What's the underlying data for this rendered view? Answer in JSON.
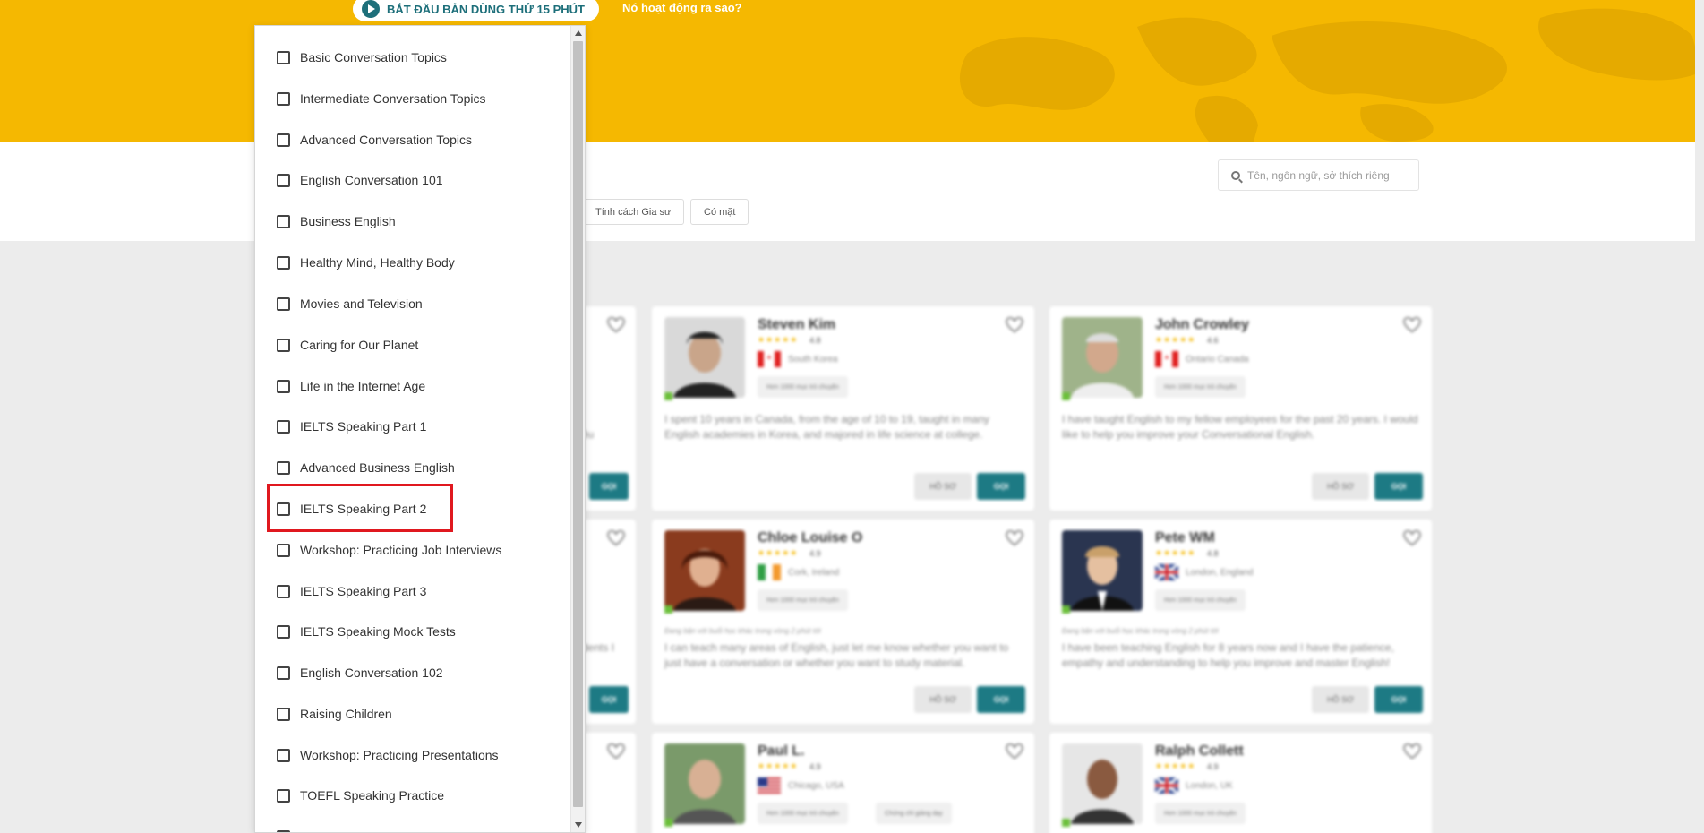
{
  "hero": {
    "trial_button": "BẮT ĐẦU BẢN DÙNG THỬ 15 PHÚT",
    "how_link": "Nó hoạt động ra sao?"
  },
  "filters": {
    "search_placeholder": "Tên, ngôn ngữ, sở thích riêng",
    "chips": [
      "Tính cách Gia sư",
      "Có mặt"
    ]
  },
  "tutors": [
    {
      "name": "Steven Kim",
      "rating": "4.8",
      "country": "South Korea",
      "tag": "Hơn 1000 mục trò chuyện",
      "note": "",
      "bio": "I spent 10 years in Canada, from the age of 10 to 19, taught in many English academies in Korea, and majored in life science at college."
    },
    {
      "name": "John Crowley",
      "rating": "4.6",
      "country": "Ontario Canada",
      "tag": "Hơn 1000 mục trò chuyện",
      "note": "",
      "bio": "I have taught English to my fellow employees for the past 20 years. I would like to help you improve your Conversational English."
    },
    {
      "name": "Chloe Louise O",
      "rating": "4.9",
      "country": "Cork, Ireland",
      "tag": "Hơn 1000 mục trò chuyện",
      "note": "Đang bận với buổi học khác trong vòng 2 phút tới",
      "bio": "I can teach many areas of English, just let me know whether you want to just have a conversation or whether you want to study material."
    },
    {
      "name": "Pete WM",
      "rating": "4.8",
      "country": "London, England",
      "tag": "Hơn 1000 mục trò chuyện",
      "note": "Đang bận với buổi học khác trong vòng 2 phút tới",
      "bio": "I have been teaching English for 8 years now and I have the patience, empathy and understanding to help you improve and master English!"
    },
    {
      "name": "Paul L.",
      "rating": "4.9",
      "country": "Chicago, USA",
      "tag": "Hơn 1000 mục trò chuyện",
      "tag2": "Chứng chỉ giảng dạy",
      "note": "",
      "bio": ""
    },
    {
      "name": "Ralph Collett",
      "rating": "4.9",
      "country": "London, UK",
      "tag": "Hơn 1000 mục trò chuyện",
      "note": "",
      "bio": ""
    }
  ],
  "card_buttons": {
    "profile": "HỒ SƠ",
    "call": "GỌI"
  },
  "partial_texts": [
    "ều",
    "dents I"
  ],
  "topics": [
    "Basic Conversation Topics",
    "Intermediate Conversation Topics",
    "Advanced Conversation Topics",
    "English Conversation 101",
    "Business English",
    "Healthy Mind, Healthy Body",
    "Movies and Television",
    "Caring for Our Planet",
    "Life in the Internet Age",
    "IELTS Speaking Part 1",
    "Advanced Business English",
    "IELTS Speaking Part 2",
    "Workshop: Practicing Job Interviews",
    "IELTS Speaking Part 3",
    "IELTS Speaking Mock Tests",
    "English Conversation 102",
    "Raising Children",
    "Workshop: Practicing Presentations",
    "TOEFL Speaking Practice"
  ],
  "colors": {
    "hero_yellow": "#f5b801",
    "teal": "#1d7a84",
    "highlight_red": "#e0181f"
  }
}
